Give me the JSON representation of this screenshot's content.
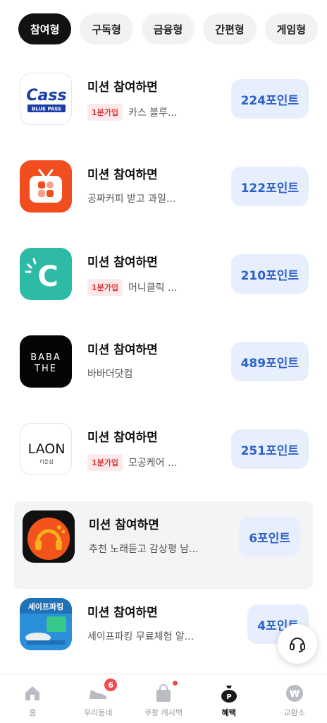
{
  "categories": [
    {
      "label": "참여형",
      "active": true
    },
    {
      "label": "구독형"
    },
    {
      "label": "금융형"
    },
    {
      "label": "간편형"
    },
    {
      "label": "게임형"
    }
  ],
  "offers": [
    {
      "title": "미션 참여하면",
      "badge": "1분가입",
      "desc": "카스 블루...",
      "points": "224포인트",
      "icon": "cass-blue-pass-logo",
      "icon_text": "Cass",
      "icon_subtext": "BLUE PASS"
    },
    {
      "title": "미션 참여하면",
      "badge": "",
      "desc": "공짜커피 받고 과일...",
      "points": "122포인트",
      "icon": "tv-app-logo"
    },
    {
      "title": "미션 참여하면",
      "badge": "1분가입",
      "desc": "머니클릭 ...",
      "points": "210포인트",
      "icon": "money-click-logo",
      "icon_text": "C"
    },
    {
      "title": "미션 참여하면",
      "badge": "",
      "desc": "바바더닷컴",
      "points": "489포인트",
      "icon": "baba-the-logo",
      "icon_text": "BABA",
      "icon_subtext": "THE"
    },
    {
      "title": "미션 참여하면",
      "badge": "1분가입",
      "desc": "모공케어 ...",
      "points": "251포인트",
      "icon": "laon-logo",
      "icon_text": "LAON",
      "icon_subtext": "라온심"
    },
    {
      "title": "미션 참여하면",
      "badge": "",
      "desc": "추천 노래듣고 감상평 남...",
      "points": "6포인트",
      "icon": "music-headphones-logo"
    },
    {
      "title": "미션 참여하면",
      "badge": "",
      "desc": "세이프파킹 무료체험 알...",
      "points": "4포인트",
      "icon": "safe-parking-logo",
      "icon_text": "세이프파킹"
    }
  ],
  "help_button": {
    "icon": "headset-icon"
  },
  "bottom_nav": [
    {
      "label": "홈",
      "icon": "home-icon"
    },
    {
      "label": "우리동네",
      "icon": "sneaker-icon",
      "badge_count": "6"
    },
    {
      "label": "쿠팡 캐시백",
      "icon": "shopping-bag-icon",
      "dot": true
    },
    {
      "label": "혜택",
      "icon": "point-bag-icon",
      "active": true
    },
    {
      "label": "교환소",
      "icon": "won-coin-icon"
    }
  ],
  "colors": {
    "accent": "#2c62c9",
    "points_bg": "#e7eefc",
    "badge_bg": "#fde8ea",
    "badge_text": "#d53a3a",
    "active_chip": "#121212"
  }
}
